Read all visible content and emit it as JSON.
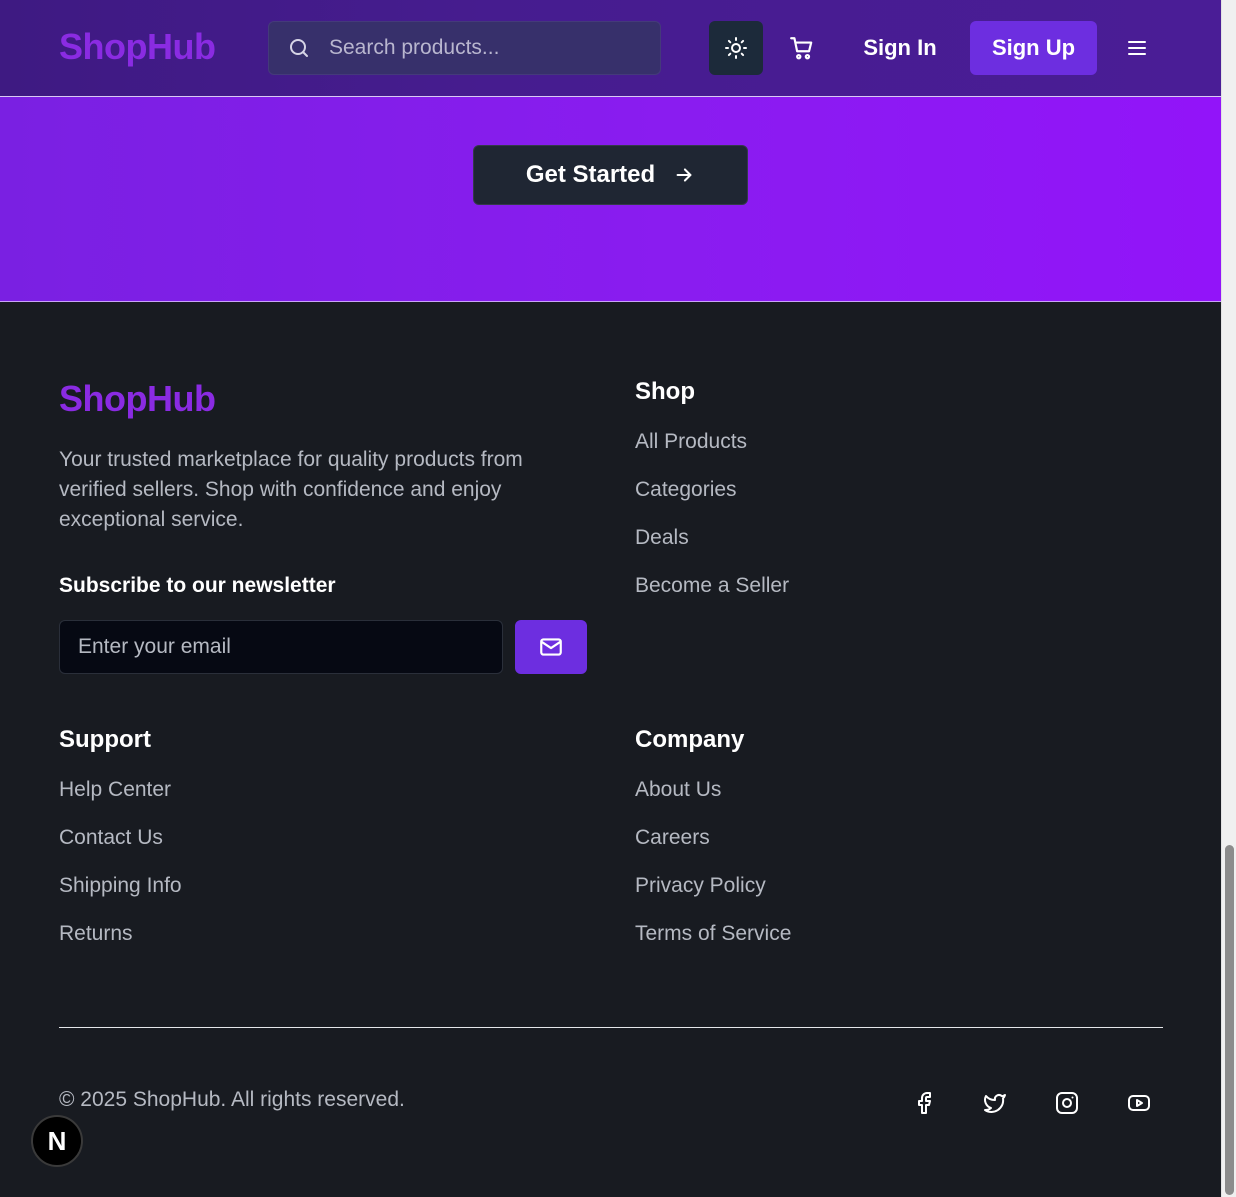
{
  "header": {
    "logo": "ShopHub",
    "search_placeholder": "Search products...",
    "theme_icon": "sun-icon",
    "cart_icon": "shopping-cart-icon",
    "sign_in": "Sign In",
    "sign_up": "Sign Up",
    "menu_icon": "hamburger-menu-icon"
  },
  "hero": {
    "cta_label": "Get Started",
    "cta_icon": "arrow-right-icon"
  },
  "footer": {
    "logo": "ShopHub",
    "description": "Your trusted marketplace for quality products from verified sellers. Shop with confidence and enjoy exceptional service.",
    "newsletter": {
      "title": "Subscribe to our newsletter",
      "placeholder": "Enter your email",
      "button_icon": "mail-icon"
    },
    "shop": {
      "title": "Shop",
      "links": [
        "All Products",
        "Categories",
        "Deals",
        "Become a Seller"
      ]
    },
    "support": {
      "title": "Support",
      "links": [
        "Help Center",
        "Contact Us",
        "Shipping Info",
        "Returns"
      ]
    },
    "company": {
      "title": "Company",
      "links": [
        "About Us",
        "Careers",
        "Privacy Policy",
        "Terms of Service"
      ]
    },
    "copyright": "© 2025 ShopHub. All rights reserved.",
    "social": [
      "facebook-icon",
      "twitter-icon",
      "instagram-icon",
      "youtube-icon"
    ]
  },
  "badge": {
    "label": "N"
  },
  "colors": {
    "brand": "#8a2be2",
    "accent_button": "#6d2ee0",
    "hero_gradient_end": "#9214f9",
    "footer_bg": "#181b21",
    "header_bg": "#461c8f"
  }
}
